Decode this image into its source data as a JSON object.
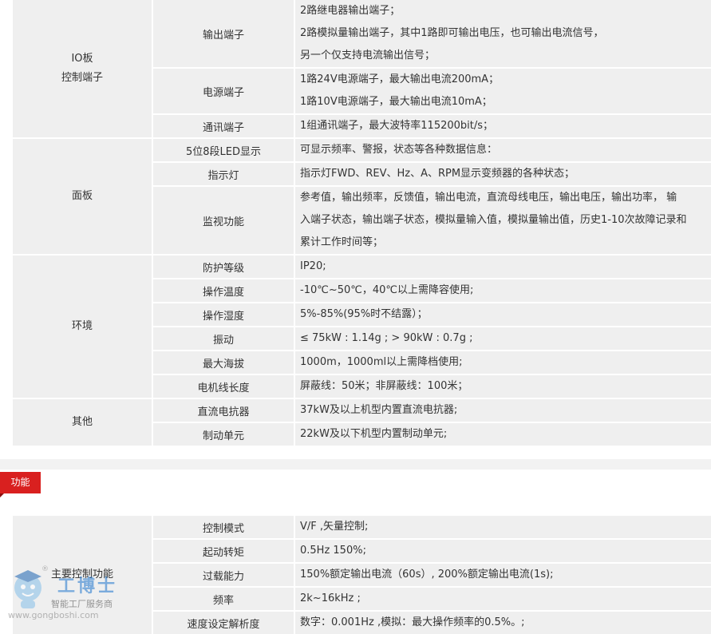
{
  "spec_top": [
    {
      "category": "IO板\n控制端子",
      "rows": [
        {
          "item": "输出端子",
          "lines": [
            "2路继电器输出端子；",
            "2路模拟量输出端子，其中1路即可输出电压，也可输出电流信号，",
            "另一个仅支持电流输出信号；"
          ]
        },
        {
          "item": "电源端子",
          "lines": [
            "1路24V电源端子，最大输出电流200mA；",
            "1路10V电源端子，最大输出电流10mA；"
          ]
        },
        {
          "item": "通讯端子",
          "lines": [
            " 1组通讯端子，最大波特率115200bit/s；"
          ]
        }
      ]
    },
    {
      "category": "面板",
      "rows": [
        {
          "item": "5位8段LED显示",
          "lines": [
            " 可显示频率、警报，状态等各种数据信息："
          ]
        },
        {
          "item": "指示灯",
          "lines": [
            " 指示灯FWD、REV、Hz、A、RPM显示变频器的各种状态；"
          ]
        },
        {
          "item": "监视功能",
          "lines": [
            " 参考值，输出频率，反馈值，输出电流，直流母线电压，输出电压，输出功率， 输",
            "入端子状态，输出端子状态，模拟量输入值，模拟量输出值，历史1-10次故障记录和",
            "累计工作时间等；"
          ]
        }
      ]
    },
    {
      "category": "环境",
      "rows": [
        {
          "item": "防护等级",
          "lines": [
            "IP20;"
          ]
        },
        {
          "item": "操作温度",
          "lines": [
            "-10℃~50℃，40℃以上需降容使用;"
          ]
        },
        {
          "item": "操作湿度",
          "lines": [
            "5%-85%(95%时不结露）；"
          ]
        },
        {
          "item": "振动",
          "lines": [
            "≤ 75kW : 1.14g ; > 90kW : 0.7g ;"
          ]
        },
        {
          "item": "最大海拔",
          "lines": [
            "1000m，1000ml以上需降档使用;"
          ]
        },
        {
          "item": "电机线长度",
          "lines": [
            "屏蔽线：50米；非屏蔽线：100米；"
          ]
        }
      ]
    },
    {
      "category": "其他",
      "rows": [
        {
          "item": "直流电抗器",
          "lines": [
            "37kW及以上机型内置直流电抗器;"
          ]
        },
        {
          "item": "制动单元",
          "lines": [
            "22kW及以下机型内置制动单元;"
          ]
        }
      ]
    }
  ],
  "section_tag": "功能",
  "spec_bottom": [
    {
      "category": "主要控制功能",
      "rows": [
        {
          "item": "控制模式",
          "lines": [
            "V/F ,矢量控制;"
          ]
        },
        {
          "item": "起动转矩",
          "lines": [
            "0.5Hz 150%;"
          ]
        },
        {
          "item": "过载能力",
          "lines": [
            "150%额定输出电流（60s）, 200%额定输出电流(1s);"
          ]
        },
        {
          "item": "频率",
          "lines": [
            "2k~16kHz ;"
          ]
        },
        {
          "item": "速度设定解析度",
          "lines": [
            "数字：0.001Hz ,模拟：最大操作频率的0.5%。;"
          ]
        }
      ]
    }
  ],
  "watermark": {
    "title": "工博士",
    "subtitle": "智能工厂服务商",
    "url": "www.gongboshi.com",
    "reg": "®"
  }
}
